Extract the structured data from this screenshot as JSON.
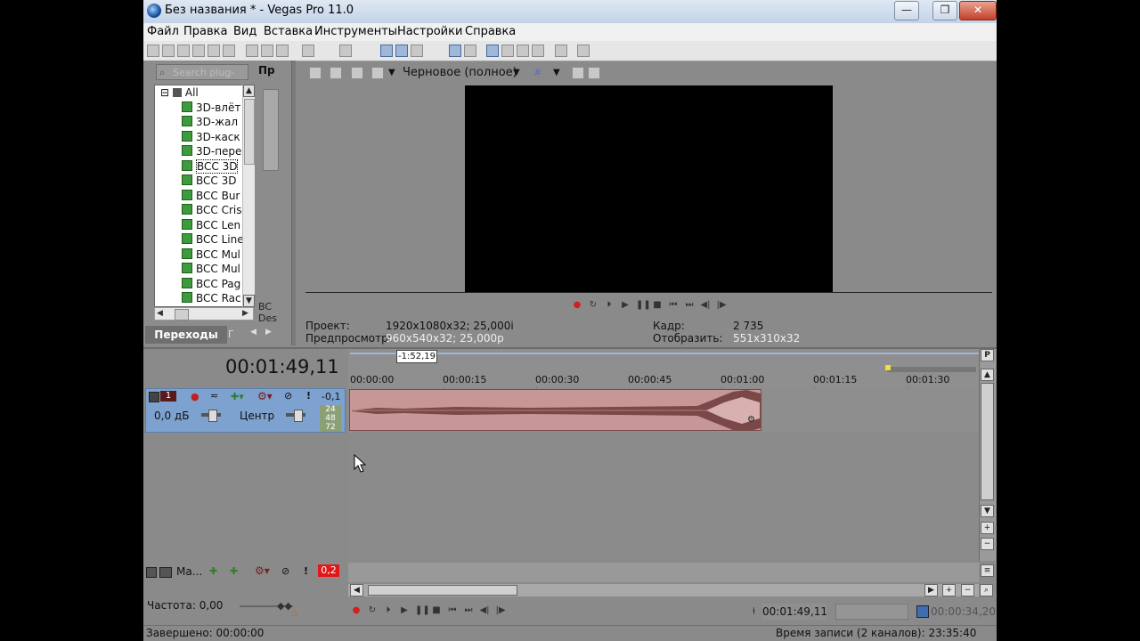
{
  "window": {
    "title": "Без названия * - Vegas Pro 11.0",
    "min": "—",
    "max": "❐",
    "close": "✕"
  },
  "menu": [
    "Файл",
    "Правка",
    "Вид",
    "Вставка",
    "Инструменты",
    "Настройки",
    "Справка"
  ],
  "plugins": {
    "search_placeholder": "Search plug-ins",
    "side_label": "Пр",
    "items": [
      "All",
      "3D-влёт",
      "3D-жал",
      "3D-каск",
      "3D-пере",
      "BCC 3D",
      "BCC 3D",
      "BCC Bur",
      "BCC Cris",
      "BCC Len",
      "BCC Line",
      "BCC Mul",
      "BCC Mul",
      "BCC Pag",
      "BCC Rac"
    ],
    "selected_index": 5,
    "side_bottom": [
      "BC",
      "Des"
    ],
    "tab_active": "Переходы",
    "tab_inactive": "Г"
  },
  "preview": {
    "quality": "Черновое (полное)",
    "project_label": "Проект:",
    "project_value": "1920x1080x32; 25,000i",
    "preview_label": "Предпросмотр:",
    "preview_value": "960x540x32; 25,000p",
    "frame_label": "Кадр:",
    "frame_value": "2 735",
    "display_label": "Отобразить:",
    "display_value": "551x310x32"
  },
  "timeline": {
    "time": "00:01:49,11",
    "cursor_label": "-1:52,19",
    "ticks": [
      "00:00:00",
      "00:00:15",
      "00:00:30",
      "00:00:45",
      "00:01:00",
      "00:01:15",
      "00:01:30"
    ],
    "marker_p": "P"
  },
  "track": {
    "number": "1",
    "volume": "0,0 дБ",
    "pan": "Центр",
    "meter": "-0,1",
    "meter_scale": [
      "24",
      "48",
      "72"
    ]
  },
  "master": {
    "label": "Ма...",
    "peak": "0,2"
  },
  "bottom": {
    "frequency": "Частота: 0,00",
    "position": "00:01:49,11",
    "length": "00:00:34,20",
    "status_left": "Завершено: 00:00:00",
    "status_right": "Время записи (2 каналов): 23:35:40"
  },
  "colors": {
    "track_header": "#7da2cf",
    "audio_clip": "#c79696",
    "peak_red": "#e01818"
  }
}
